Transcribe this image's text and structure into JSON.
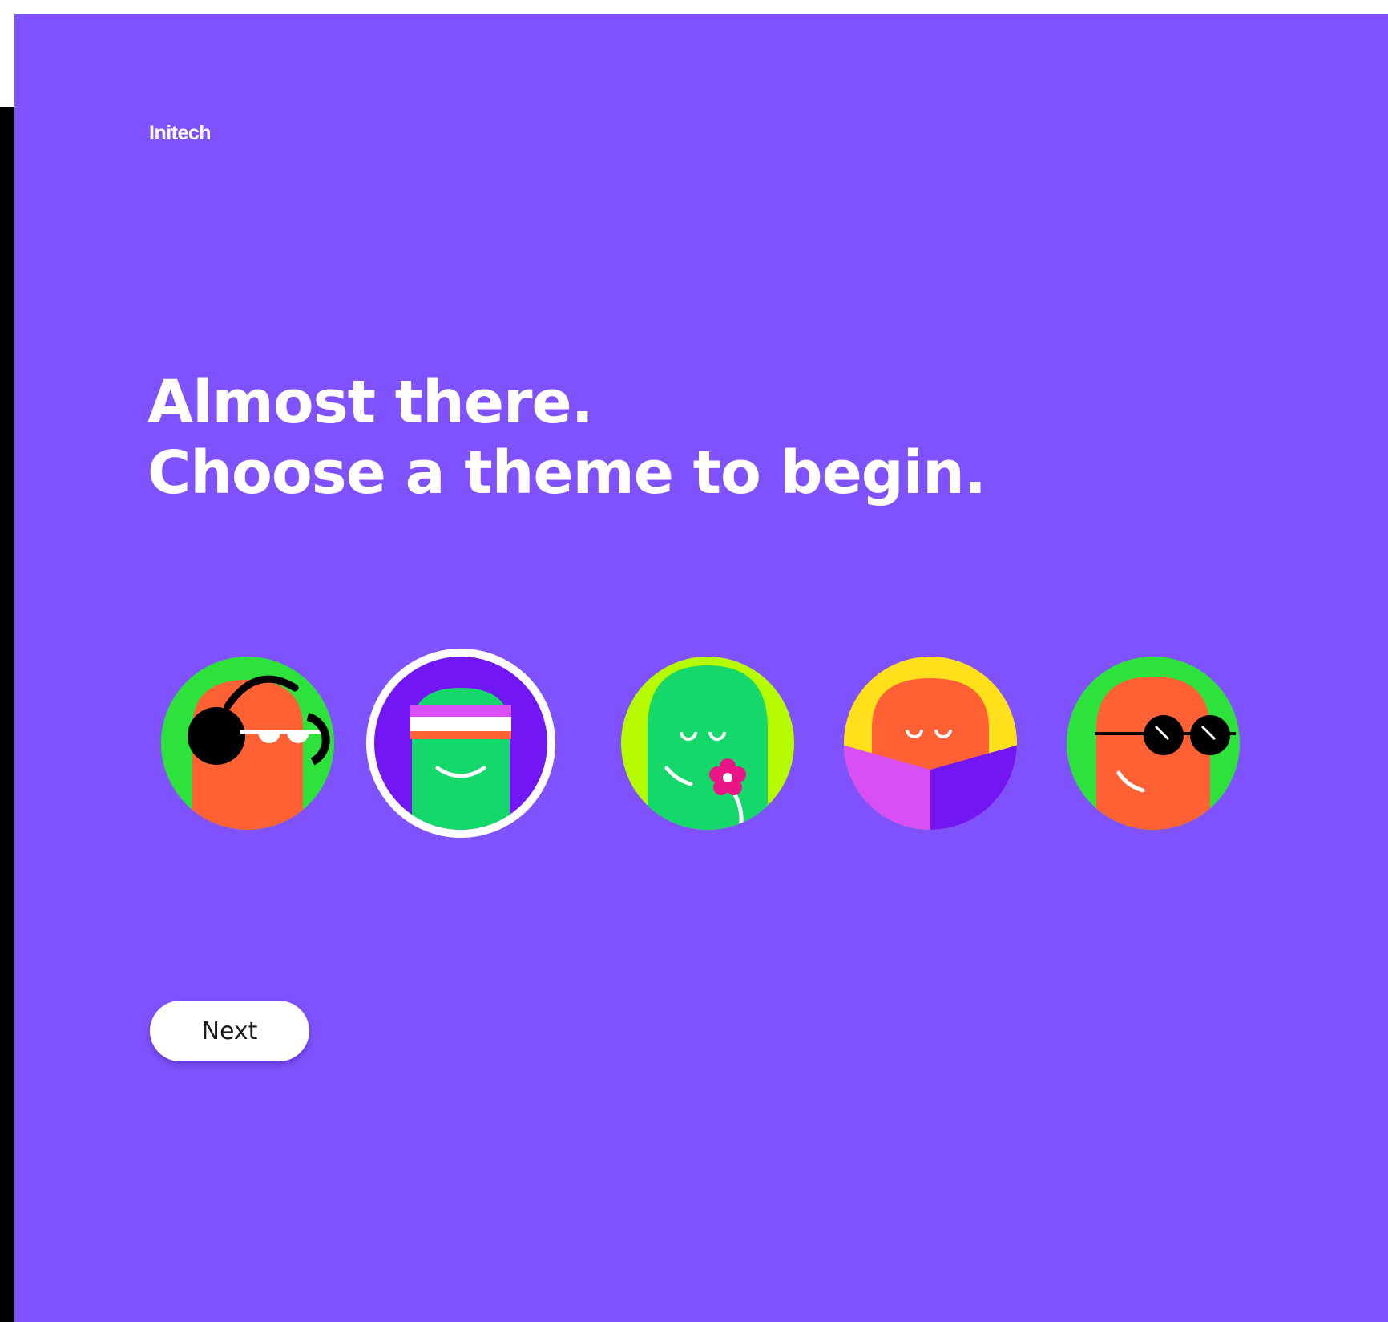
{
  "app": {
    "brand": "Initech",
    "background_color": "#8052fd"
  },
  "headline": {
    "line1": "Almost there.",
    "line2": "Choose a theme to begin."
  },
  "themes": {
    "selected_index": 1,
    "items": [
      {
        "name": "theme-headphones",
        "bg": "#2ee23c",
        "character": "#ff6135"
      },
      {
        "name": "theme-headband",
        "bg": "#7217f4",
        "character": "#15d86a",
        "selected": true
      },
      {
        "name": "theme-flower",
        "bg": "#b6fb00",
        "character": "#15d86a"
      },
      {
        "name": "theme-reading",
        "bg": "#ffe01a",
        "character": "#ff6135"
      },
      {
        "name": "theme-sunglasses",
        "bg": "#2ee23c",
        "character": "#ff6135"
      }
    ]
  },
  "actions": {
    "next_label": "Next"
  }
}
